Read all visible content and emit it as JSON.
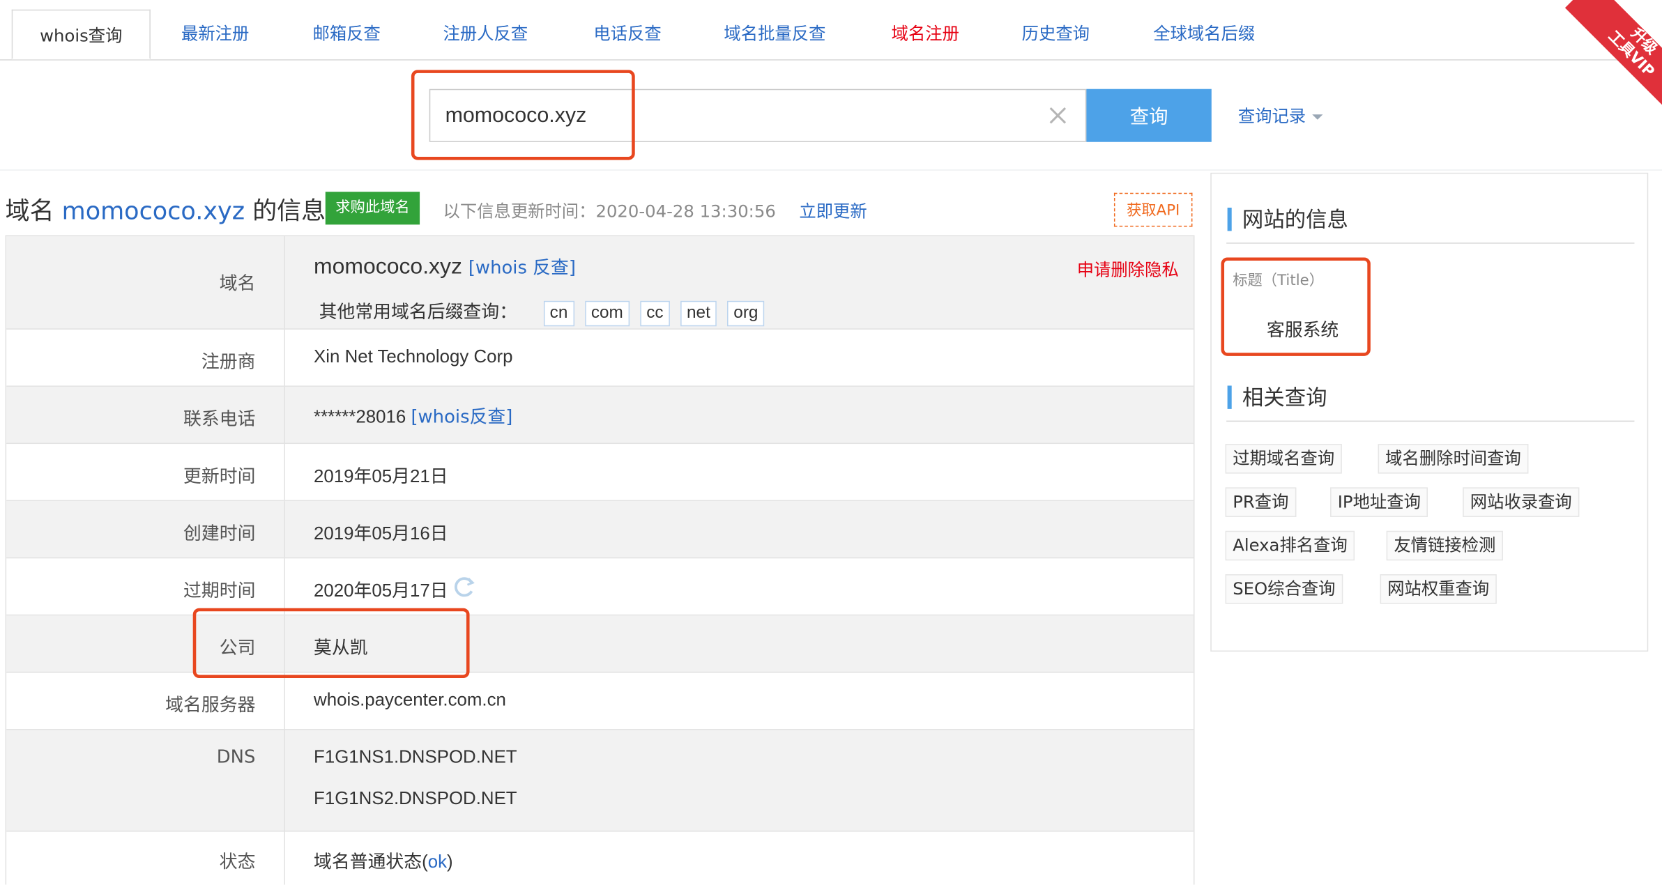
{
  "tabs": [
    {
      "label": "whois查询",
      "active": true
    },
    {
      "label": "最新注册"
    },
    {
      "label": "邮箱反查"
    },
    {
      "label": "注册人反查"
    },
    {
      "label": "电话反查"
    },
    {
      "label": "域名批量反查"
    },
    {
      "label": "域名注册",
      "color": "#e60012"
    },
    {
      "label": "历史查询"
    },
    {
      "label": "全球域名后缀"
    }
  ],
  "vip_ribbon": {
    "line1": "升级",
    "line2": "工具VIP"
  },
  "search": {
    "value": "momococo.xyz",
    "button": "查询",
    "history": "查询记录"
  },
  "heading": {
    "prefix": "域名",
    "domain": "momococo.xyz",
    "suffix": "的信息",
    "buy_badge": "求购此域名",
    "update_label": "以下信息更新时间：2020-04-28 13:30:56",
    "update_link": "立即更新",
    "api": "获取API"
  },
  "info": {
    "domain_label": "域名",
    "domain_value": "momococo.xyz",
    "whois_reverse": "[whois 反查]",
    "delete_privacy": "申请删除隐私",
    "tld_prompt": "其他常用域名后缀查询：",
    "tlds": [
      "cn",
      "com",
      "cc",
      "net",
      "org"
    ],
    "registrar_label": "注册商",
    "registrar": "Xin Net Technology Corp",
    "phone_label": "联系电话",
    "phone": "******28016",
    "phone_reverse": "[whois反查]",
    "updated_label": "更新时间",
    "updated": "2019年05月21日",
    "created_label": "创建时间",
    "created": "2019年05月16日",
    "expires_label": "过期时间",
    "expires": "2020年05月17日",
    "company_label": "公司",
    "company": "莫从凯",
    "whois_server_label": "域名服务器",
    "whois_server": "whois.paycenter.com.cn",
    "dns_label": "DNS",
    "dns": [
      "F1G1NS1.DNSPOD.NET",
      "F1G1NS2.DNSPOD.NET"
    ],
    "status_label": "状态",
    "status_text": "域名普通状态(",
    "status_code": "ok",
    "status_close": ")"
  },
  "side": {
    "site_info_title": "网站的信息",
    "title_label": "标题（Title）",
    "title_value": "客服系统",
    "related_title": "相关查询",
    "links": [
      "过期域名查询",
      "域名删除时间查询",
      "PR查询",
      "IP地址查询",
      "网站收录查询",
      "Alexa排名查询",
      "友情链接检测",
      "SEO综合查询",
      "网站权重查询"
    ]
  },
  "colors": {
    "link": "#2a6ac4",
    "red": "#e60012",
    "accent": "#4da2e8",
    "highlight": "#e8471f",
    "badge_green": "#32a33a"
  }
}
